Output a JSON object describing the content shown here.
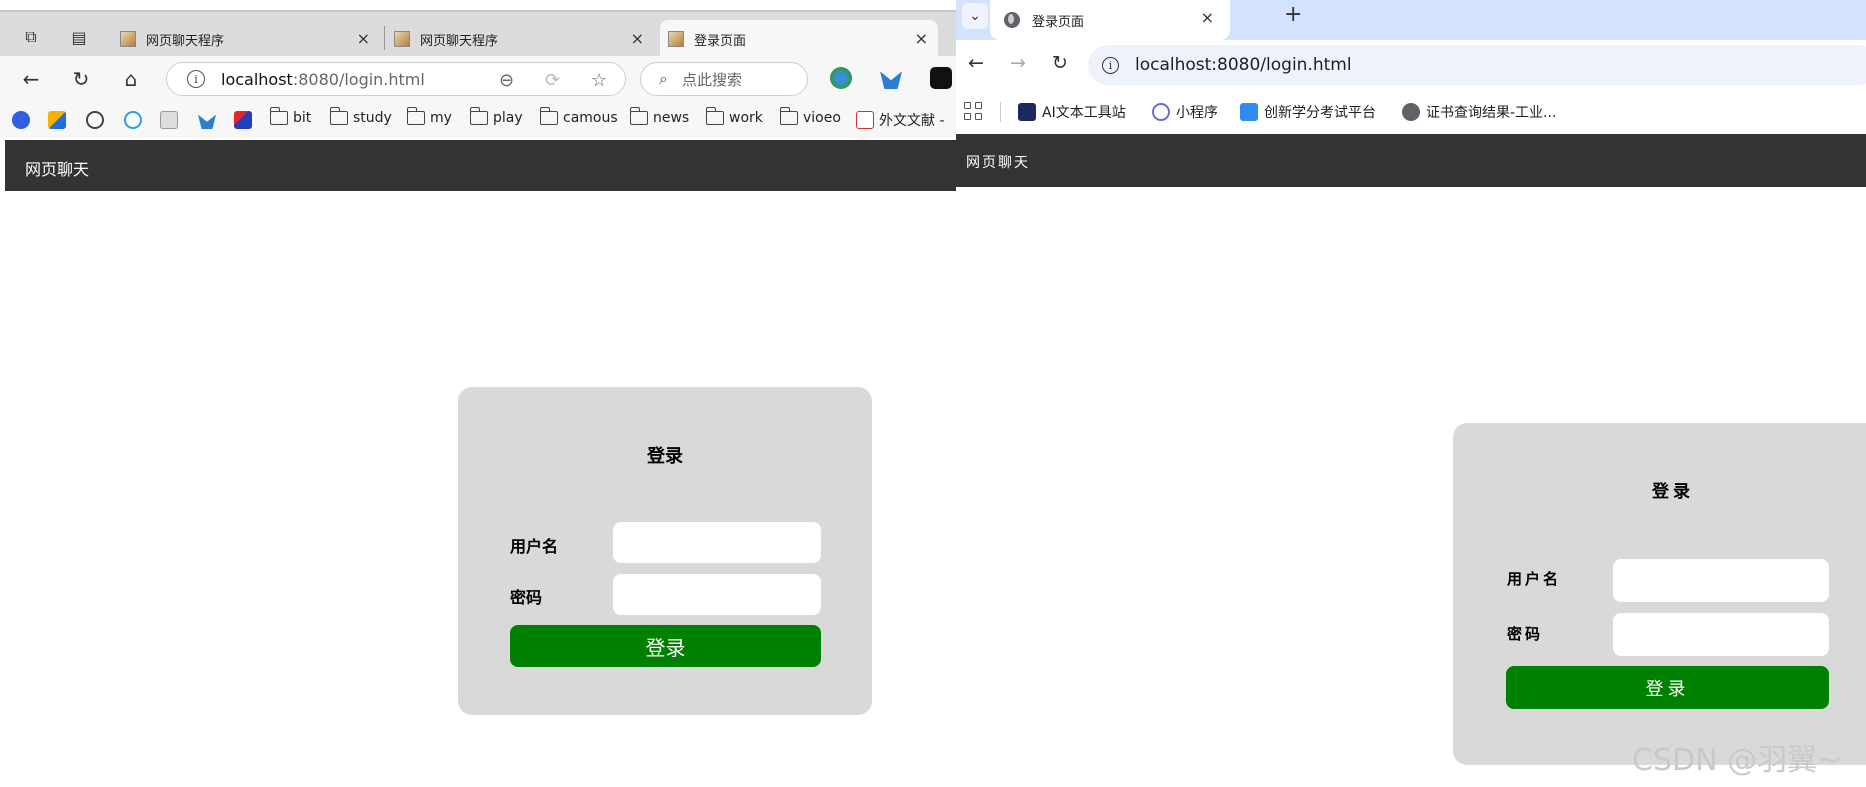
{
  "left_browser": {
    "tabs": [
      {
        "title": "网页聊天程序",
        "close": "×"
      },
      {
        "title": "网页聊天程序",
        "close": "×"
      },
      {
        "title": "登录页面",
        "close": "×",
        "active": true
      }
    ],
    "url_host": "localhost",
    "url_rest": ":8080/login.html",
    "search_placeholder": "点此搜索",
    "bookmarks": [
      "bit",
      "study",
      "my",
      "play",
      "camous",
      "news",
      "work",
      "vioeo",
      "外文文献 - "
    ],
    "app_title": "网页聊天",
    "card": {
      "title": "登录",
      "username_label": "用户名",
      "password_label": "密码",
      "submit": "登录"
    }
  },
  "right_browser": {
    "tab": {
      "title": "登录页面",
      "close": "×"
    },
    "new_tab": "+",
    "url": "localhost:8080/login.html",
    "bookmarks": [
      "AI文本工具站",
      "小程序",
      "创新学分考试平台",
      "证书查询结果-工业..."
    ],
    "app_title": "网页聊天",
    "card": {
      "title": "登录",
      "username_label": "用户名",
      "password_label": "密码",
      "submit": "登录"
    }
  },
  "watermark": "CSDN @羽翼~",
  "colors": {
    "appbar": "#333333",
    "card": "#d9d9d9",
    "button": "#008000"
  }
}
